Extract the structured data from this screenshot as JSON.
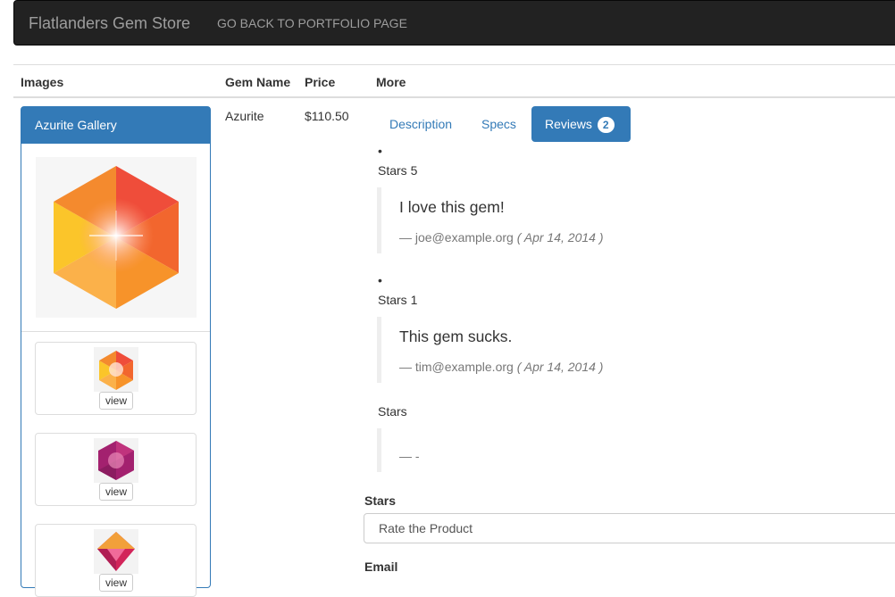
{
  "navbar": {
    "brand": "Flatlanders Gem Store",
    "link": "GO BACK TO PORTFOLIO PAGE",
    "bg_color": "#222222"
  },
  "table": {
    "headers": {
      "images": "Images",
      "name": "Gem Name",
      "price": "Price",
      "more": "More"
    },
    "row": {
      "name": "Azurite",
      "price": "$110.50"
    }
  },
  "gallery": {
    "title": "Azurite Gallery",
    "accent_color": "#337ab7",
    "thumbnails": [
      {
        "icon": "orange-gem-icon",
        "button": "view"
      },
      {
        "icon": "purple-gem-icon",
        "button": "view"
      },
      {
        "icon": "red-gem-icon",
        "button": "view"
      }
    ]
  },
  "tabs": [
    {
      "label": "Description",
      "active": false
    },
    {
      "label": "Specs",
      "active": false
    },
    {
      "label": "Reviews",
      "active": true,
      "badge": "2"
    }
  ],
  "reviews": [
    {
      "bullet": "•",
      "stars": "Stars 5",
      "body": "I love this gem!",
      "dash": "—",
      "author": "joe@example.org",
      "date": "( Apr 14, 2014 )"
    },
    {
      "bullet": "•",
      "stars": "Stars 1",
      "body": "This gem sucks.",
      "dash": "—",
      "author": "tim@example.org",
      "date": "( Apr 14, 2014 )"
    }
  ],
  "preview": {
    "stars": "Stars",
    "footer": "— -"
  },
  "form": {
    "stars_label": "Stars",
    "stars_select_value": "Rate the Product",
    "email_label": "Email"
  }
}
